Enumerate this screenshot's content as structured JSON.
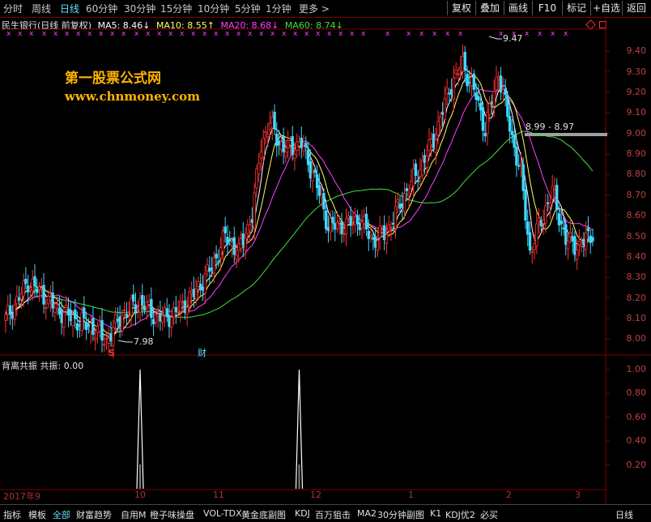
{
  "periods": [
    "分时",
    "周线",
    "日线",
    "60分钟",
    "30分钟",
    "15分钟",
    "10分钟",
    "5分钟",
    "1分钟",
    "更多 >"
  ],
  "active_period": "日线",
  "tools": [
    "复权",
    "叠加",
    "画线",
    "F10",
    "标记",
    "+自选",
    "返回"
  ],
  "chart_title": "民生银行(日线 前复权)",
  "ma": {
    "ma5": "MA5: 8.46↓",
    "ma10": "MA10: 8.55↑",
    "ma20": "MA20: 8.68↓",
    "ma60": "MA60: 8.74↓"
  },
  "colors": {
    "ma5": "#ffffff",
    "ma10": "#ffff60",
    "ma20": "#ff40ff",
    "ma60": "#40e040",
    "up": "#ff3030",
    "down": "#40d8ff",
    "axis": "#c04040"
  },
  "watermark": {
    "line1": "第一股票公式网",
    "line2": "www.chnmoney.com"
  },
  "price_axis": [
    "9.40",
    "9.30",
    "9.20",
    "9.10",
    "9.00",
    "8.90",
    "8.80",
    "8.70",
    "8.60",
    "8.50",
    "8.40",
    "8.30",
    "8.20",
    "8.10",
    "8.00"
  ],
  "annotations": {
    "high": "9.47",
    "low": "7.98",
    "range": "8.99 - 8.97",
    "s_marker": "S",
    "cai_marker": "财"
  },
  "indicator": {
    "title": "背离共振  共振: 0.00",
    "axis": [
      "1.00",
      "0.80",
      "0.60",
      "0.40",
      "0.20"
    ]
  },
  "months": [
    "2017年9",
    "10",
    "11",
    "12",
    "1",
    "2",
    "3"
  ],
  "bottom_tabs": [
    "指标",
    "模板",
    "全部",
    "财富趋势",
    "自用M",
    "橙子味操盘",
    "VOL-TDX",
    "黄金底副图",
    "KDJ",
    "百万狙击",
    "MA2",
    "30分钟副图",
    "K1",
    "KDJ优2",
    "必买"
  ],
  "active_bottom_tab": "全部",
  "bottom_right": "日线",
  "chart_data": {
    "type": "candlestick",
    "title": "民生银行(日线 前复权)",
    "ylim": [
      7.93,
      9.5
    ],
    "high_label": 9.47,
    "low_label": 7.98,
    "indicator_series": {
      "name": "共振",
      "ylim": [
        0,
        1.0
      ],
      "spikes_at_candle": [
        60,
        131
      ],
      "current": 0.0
    }
  }
}
